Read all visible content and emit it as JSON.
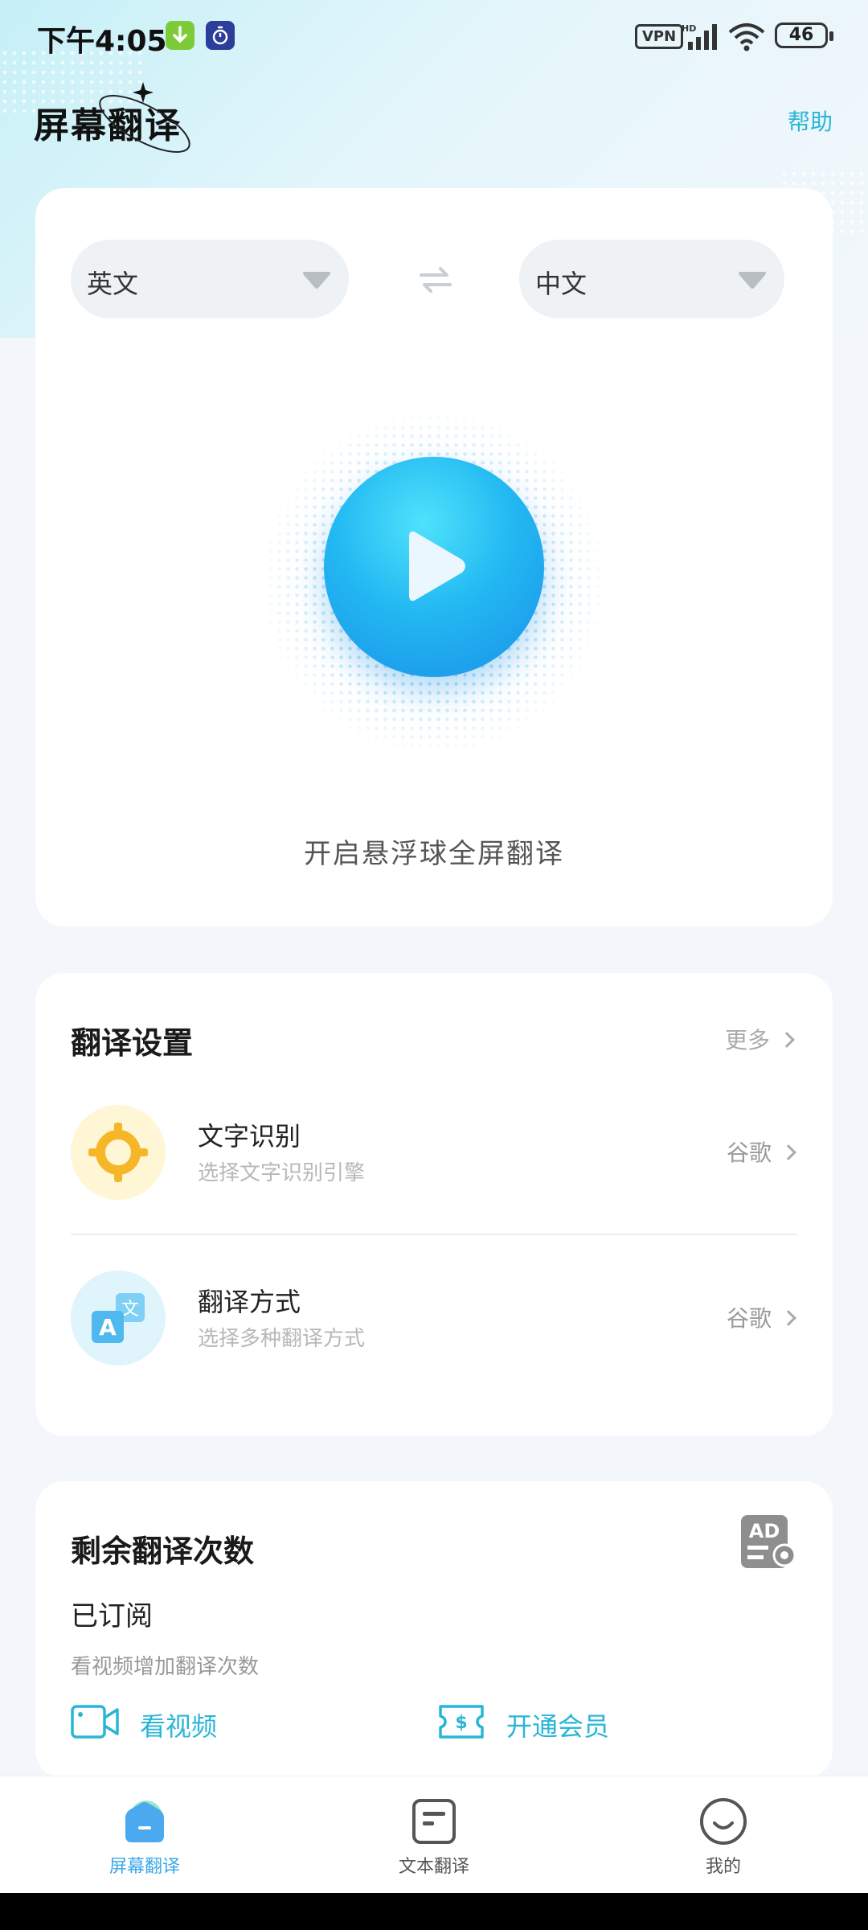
{
  "status_bar": {
    "time": "下午4:05",
    "vpn": "VPN",
    "battery": "46"
  },
  "header": {
    "title": "屏幕翻译",
    "help": "帮助"
  },
  "translator": {
    "source_lang": "英文",
    "target_lang": "中文",
    "start_label": "开启悬浮球全屏翻译"
  },
  "settings": {
    "title": "翻译设置",
    "more": "更多",
    "items": [
      {
        "title": "文字识别",
        "subtitle": "选择文字识别引擎",
        "value": "谷歌"
      },
      {
        "title": "翻译方式",
        "subtitle": "选择多种翻译方式",
        "value": "谷歌"
      }
    ]
  },
  "quota": {
    "title": "剩余翻译次数",
    "status": "已订阅",
    "hint": "看视频增加翻译次数",
    "watch_video": "看视频",
    "open_vip": "开通会员"
  },
  "nav": {
    "items": [
      {
        "label": "屏幕翻译",
        "active": true
      },
      {
        "label": "文本翻译",
        "active": false
      },
      {
        "label": "我的",
        "active": false
      }
    ]
  },
  "colors": {
    "accent": "#29b6d6",
    "play_gradient_top": "#4fe2fb",
    "play_gradient_bottom": "#1a8fe8"
  }
}
